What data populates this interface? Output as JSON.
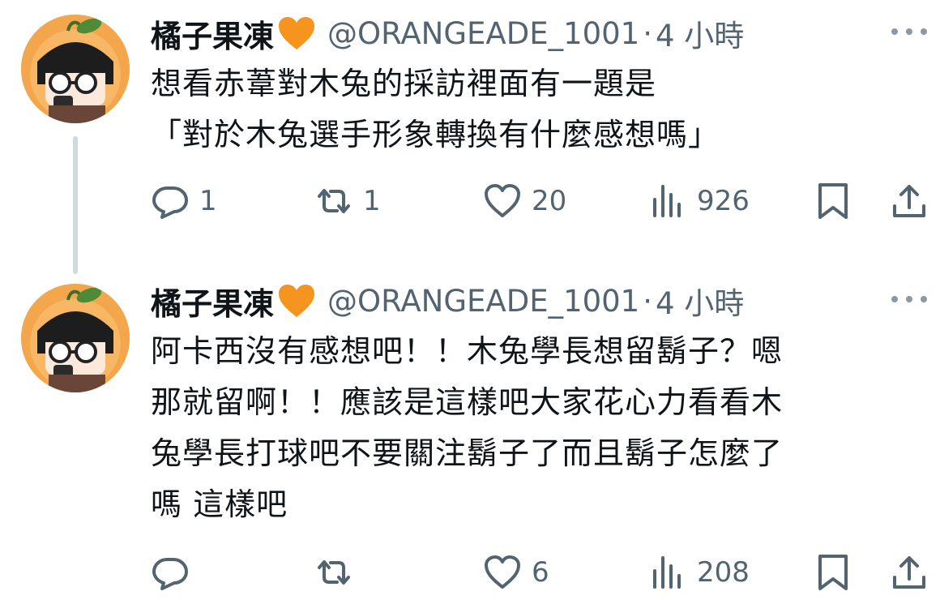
{
  "tweets": [
    {
      "author": {
        "display_name": "橘子果凍",
        "emoji": "orange-heart",
        "handle": "@ORANGEADE_1001"
      },
      "separator": "·",
      "time": "4 小時",
      "text_lines": [
        "想看赤葦對木兔的採訪裡面有一題是",
        "「對於木兔選手形象轉換有什麼感想嗎」"
      ],
      "actions": {
        "replies": "1",
        "retweets": "1",
        "likes": "20",
        "views": "926"
      }
    },
    {
      "author": {
        "display_name": "橘子果凍",
        "emoji": "orange-heart",
        "handle": "@ORANGEADE_1001"
      },
      "separator": "·",
      "time": "4 小時",
      "text_lines": [
        "阿卡西沒有感想吧！！木兔學長想留鬍子？嗯",
        "那就留啊！！應該是這樣吧大家花心力看看木",
        "兔學長打球吧不要關注鬍子了而且鬍子怎麼了",
        "嗎  這樣吧"
      ],
      "actions": {
        "replies": "",
        "retweets": "",
        "likes": "6",
        "views": "208"
      }
    }
  ],
  "colors": {
    "text_primary": "#0f1419",
    "text_secondary": "#536471",
    "thread_line": "#cfd9de",
    "emoji_heart": "#f5941e",
    "avatar_orange": "#f4a64c"
  },
  "icons": [
    "reply-icon",
    "retweet-icon",
    "like-icon",
    "views-icon",
    "bookmark-icon",
    "share-icon",
    "more-icon",
    "orange-heart-icon"
  ]
}
